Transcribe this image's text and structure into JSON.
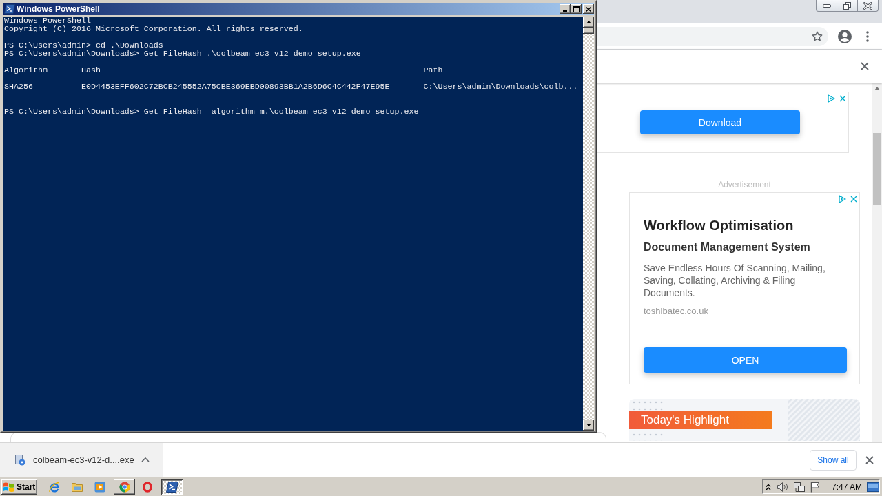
{
  "powershell": {
    "title": "Windows PowerShell",
    "lines": [
      {
        "kind": "text",
        "text": "Windows PowerShell"
      },
      {
        "kind": "text",
        "text": "Copyright (C) 2016 Microsoft Corporation. All rights reserved."
      },
      {
        "kind": "blank"
      },
      {
        "kind": "text",
        "text": "PS C:\\Users\\admin> cd .\\Downloads"
      },
      {
        "kind": "text",
        "text": "PS C:\\Users\\admin\\Downloads> Get-FileHash .\\colbeam-ec3-v12-demo-setup.exe"
      },
      {
        "kind": "blank"
      },
      {
        "kind": "table",
        "columns": [
          "Algorithm",
          "Hash",
          "Path"
        ],
        "rules": [
          "---------",
          "----",
          "----"
        ],
        "rows": [
          [
            "SHA256",
            "E0D4453EFF602C72BCB245552A75CBE369EBD00893BB1A2B6D6C4C442F47E95E",
            "C:\\Users\\admin\\Downloads\\colb..."
          ]
        ]
      },
      {
        "kind": "blank"
      },
      {
        "kind": "blank"
      },
      {
        "kind": "text",
        "text": "PS C:\\Users\\admin\\Downloads> Get-FileHash -algorithm m.\\colbeam-ec3-v12-demo-setup.exe"
      }
    ]
  },
  "browser": {
    "top_ad": {
      "button": "Download"
    },
    "ad_label": "Advertisement",
    "side_ad": {
      "title": "Workflow Optimisation",
      "subtitle": "Document Management System",
      "description": "Save Endless Hours Of Scanning, Mailing, Saving, Collating, Archiving & Filing Documents.",
      "domain": "toshibatec.co.uk",
      "button": "OPEN"
    },
    "highlight": {
      "label": "Today's Highlight"
    },
    "download_shelf": {
      "items": [
        {
          "name": "colbeam-ec3-v12-d....exe"
        }
      ],
      "show_all": "Show all"
    }
  },
  "taskbar": {
    "start": "Start",
    "items": [
      {
        "kind": "launcher"
      },
      {
        "kind": "launcher"
      },
      {
        "kind": "launcher"
      },
      {
        "kind": "task",
        "selected": false
      },
      {
        "kind": "launcher"
      },
      {
        "kind": "task",
        "selected": true
      }
    ],
    "clock": "7:47 AM"
  }
}
